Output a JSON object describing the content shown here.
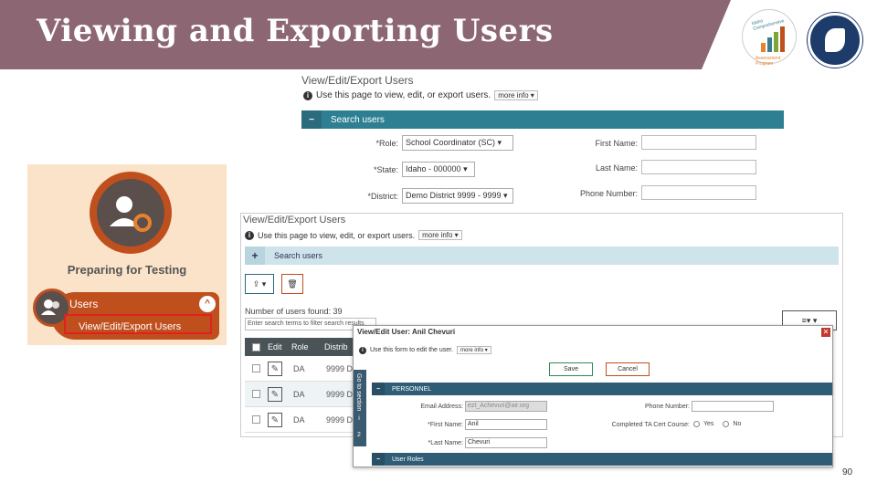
{
  "slide": {
    "title": "Viewing and Exporting Users",
    "page_number": "90",
    "logo_left": {
      "top_text": "Idaho Comprehensive",
      "bottom_text": "Assessment Program"
    }
  },
  "shot_top": {
    "title": "View/Edit/Export Users",
    "info": "Use this page to view, edit, or export users.",
    "more_info": "more info",
    "search_bar": "Search users",
    "fields": [
      {
        "label": "*Role:",
        "value": "School Coordinator (SC)"
      },
      {
        "label": "*State:",
        "value": "Idaho - 000000"
      },
      {
        "label": "*District:",
        "value": "Demo District 9999 - 9999"
      }
    ],
    "right_fields": [
      {
        "label": "First Name:"
      },
      {
        "label": "Last Name:"
      },
      {
        "label": "Phone Number:"
      }
    ]
  },
  "left_panel": {
    "title": "Preparing for Testing",
    "users_label": "Users",
    "submenu_label": "View/Edit/Export Users"
  },
  "shot_mid": {
    "title": "View/Edit/Export Users",
    "info": "Use this page to view, edit, or export users.",
    "more_info": "more info",
    "search_bar": "Search users",
    "found": "Number of users found: 39",
    "filter_placeholder": "Enter search terms to filter search results",
    "columns": [
      "Edit",
      "Role",
      "Distrib"
    ],
    "rows": [
      {
        "role": "DA",
        "dist": "9999 D"
      },
      {
        "role": "DA",
        "dist": "9999 De"
      },
      {
        "role": "DA",
        "dist": "9999 De"
      }
    ]
  },
  "dialog": {
    "header": "View/Edit User: Anil Chevuri",
    "info": "Use this form to edit the user.",
    "more_info": "more info",
    "save": "Save",
    "cancel": "Cancel",
    "side_tab": "Go to section",
    "section_personnel": "PERSONNEL",
    "section_roles": "User Roles",
    "email_label": "Email Address:",
    "email_value": "ezt_Achevuri@air.org",
    "first_label": "*First Name:",
    "first_value": "Anil",
    "last_label": "*Last Name:",
    "last_value": "Chevuri",
    "phone_label": "Phone Number:",
    "cert_label": "Completed TA Cert Course:",
    "yes": "Yes",
    "no": "No"
  }
}
